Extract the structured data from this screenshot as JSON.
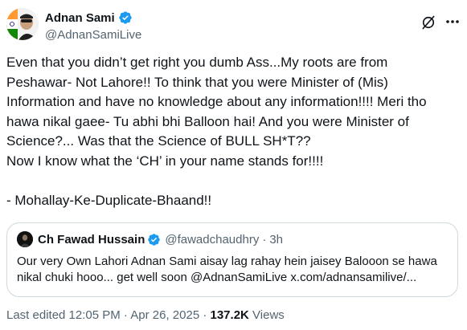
{
  "tweet": {
    "author_name": "Adnan Sami",
    "author_handle": "@AdnanSamiLive",
    "text": "Even that you didn’t get right you dumb Ass...My roots are from\nPeshawar- Not Lahore!! To think that you were Minister of (Mis)\nInformation and have no knowledge about any information!!!! Meri tho\nhawa nikal gaee- Tu abhi bhi Balloon hai! And you were Minister of\nScience?... Was that the Science of BULL SH*T??\nNow I know what the ‘CH’ in your name stands for!!!!\n\n- Mohallay-Ke-Duplicate-Bhaand!!"
  },
  "quoted_tweet": {
    "author_name": "Ch Fawad Hussain",
    "author_handle": "@fawadchaudhry",
    "separator": "·",
    "time": "3h",
    "text": "Our very Own Lahori Adnan Sami aisay lag rahay hein jaisey Balooon se hawa\nnikal chuki hooo... get well soon @AdnanSamiLive x.com/adnansamilive/..."
  },
  "meta": {
    "edited_label": "Last edited 12:05 PM · Apr 26, 2025 · ",
    "views_count": "137.2K",
    "views_label": " Views"
  },
  "colors": {
    "verified_blue": "#1d9bf0",
    "secondary_text": "#536471",
    "border": "#cfd9de"
  },
  "icons": [
    "verified-badge-icon",
    "grok-icon",
    "more-options-icon"
  ]
}
